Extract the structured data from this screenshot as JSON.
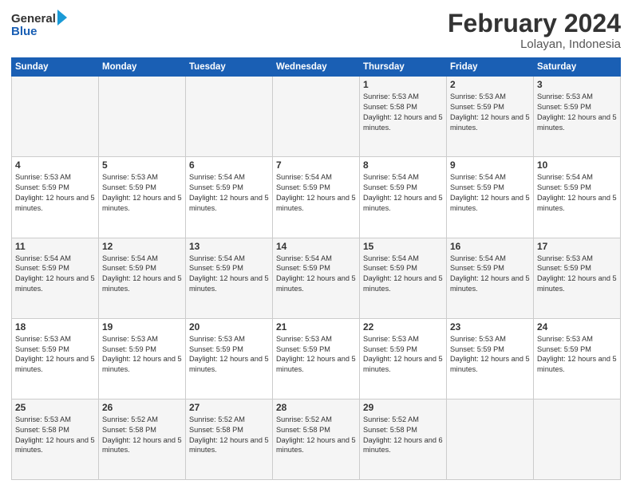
{
  "logo": {
    "line1": "General",
    "line2": "Blue"
  },
  "title": "February 2024",
  "location": "Lolayan, Indonesia",
  "days_header": [
    "Sunday",
    "Monday",
    "Tuesday",
    "Wednesday",
    "Thursday",
    "Friday",
    "Saturday"
  ],
  "weeks": [
    [
      {
        "day": "",
        "text": ""
      },
      {
        "day": "",
        "text": ""
      },
      {
        "day": "",
        "text": ""
      },
      {
        "day": "",
        "text": ""
      },
      {
        "day": "1",
        "text": "Sunrise: 5:53 AM\nSunset: 5:58 PM\nDaylight: 12 hours\nand 5 minutes."
      },
      {
        "day": "2",
        "text": "Sunrise: 5:53 AM\nSunset: 5:59 PM\nDaylight: 12 hours\nand 5 minutes."
      },
      {
        "day": "3",
        "text": "Sunrise: 5:53 AM\nSunset: 5:59 PM\nDaylight: 12 hours\nand 5 minutes."
      }
    ],
    [
      {
        "day": "4",
        "text": "Sunrise: 5:53 AM\nSunset: 5:59 PM\nDaylight: 12 hours\nand 5 minutes."
      },
      {
        "day": "5",
        "text": "Sunrise: 5:53 AM\nSunset: 5:59 PM\nDaylight: 12 hours\nand 5 minutes."
      },
      {
        "day": "6",
        "text": "Sunrise: 5:54 AM\nSunset: 5:59 PM\nDaylight: 12 hours\nand 5 minutes."
      },
      {
        "day": "7",
        "text": "Sunrise: 5:54 AM\nSunset: 5:59 PM\nDaylight: 12 hours\nand 5 minutes."
      },
      {
        "day": "8",
        "text": "Sunrise: 5:54 AM\nSunset: 5:59 PM\nDaylight: 12 hours\nand 5 minutes."
      },
      {
        "day": "9",
        "text": "Sunrise: 5:54 AM\nSunset: 5:59 PM\nDaylight: 12 hours\nand 5 minutes."
      },
      {
        "day": "10",
        "text": "Sunrise: 5:54 AM\nSunset: 5:59 PM\nDaylight: 12 hours\nand 5 minutes."
      }
    ],
    [
      {
        "day": "11",
        "text": "Sunrise: 5:54 AM\nSunset: 5:59 PM\nDaylight: 12 hours\nand 5 minutes."
      },
      {
        "day": "12",
        "text": "Sunrise: 5:54 AM\nSunset: 5:59 PM\nDaylight: 12 hours\nand 5 minutes."
      },
      {
        "day": "13",
        "text": "Sunrise: 5:54 AM\nSunset: 5:59 PM\nDaylight: 12 hours\nand 5 minutes."
      },
      {
        "day": "14",
        "text": "Sunrise: 5:54 AM\nSunset: 5:59 PM\nDaylight: 12 hours\nand 5 minutes."
      },
      {
        "day": "15",
        "text": "Sunrise: 5:54 AM\nSunset: 5:59 PM\nDaylight: 12 hours\nand 5 minutes."
      },
      {
        "day": "16",
        "text": "Sunrise: 5:54 AM\nSunset: 5:59 PM\nDaylight: 12 hours\nand 5 minutes."
      },
      {
        "day": "17",
        "text": "Sunrise: 5:53 AM\nSunset: 5:59 PM\nDaylight: 12 hours\nand 5 minutes."
      }
    ],
    [
      {
        "day": "18",
        "text": "Sunrise: 5:53 AM\nSunset: 5:59 PM\nDaylight: 12 hours\nand 5 minutes."
      },
      {
        "day": "19",
        "text": "Sunrise: 5:53 AM\nSunset: 5:59 PM\nDaylight: 12 hours\nand 5 minutes."
      },
      {
        "day": "20",
        "text": "Sunrise: 5:53 AM\nSunset: 5:59 PM\nDaylight: 12 hours\nand 5 minutes."
      },
      {
        "day": "21",
        "text": "Sunrise: 5:53 AM\nSunset: 5:59 PM\nDaylight: 12 hours\nand 5 minutes."
      },
      {
        "day": "22",
        "text": "Sunrise: 5:53 AM\nSunset: 5:59 PM\nDaylight: 12 hours\nand 5 minutes."
      },
      {
        "day": "23",
        "text": "Sunrise: 5:53 AM\nSunset: 5:59 PM\nDaylight: 12 hours\nand 5 minutes."
      },
      {
        "day": "24",
        "text": "Sunrise: 5:53 AM\nSunset: 5:59 PM\nDaylight: 12 hours\nand 5 minutes."
      }
    ],
    [
      {
        "day": "25",
        "text": "Sunrise: 5:53 AM\nSunset: 5:58 PM\nDaylight: 12 hours\nand 5 minutes."
      },
      {
        "day": "26",
        "text": "Sunrise: 5:52 AM\nSunset: 5:58 PM\nDaylight: 12 hours\nand 5 minutes."
      },
      {
        "day": "27",
        "text": "Sunrise: 5:52 AM\nSunset: 5:58 PM\nDaylight: 12 hours\nand 5 minutes."
      },
      {
        "day": "28",
        "text": "Sunrise: 5:52 AM\nSunset: 5:58 PM\nDaylight: 12 hours\nand 5 minutes."
      },
      {
        "day": "29",
        "text": "Sunrise: 5:52 AM\nSunset: 5:58 PM\nDaylight: 12 hours\nand 6 minutes."
      },
      {
        "day": "",
        "text": ""
      },
      {
        "day": "",
        "text": ""
      }
    ]
  ]
}
